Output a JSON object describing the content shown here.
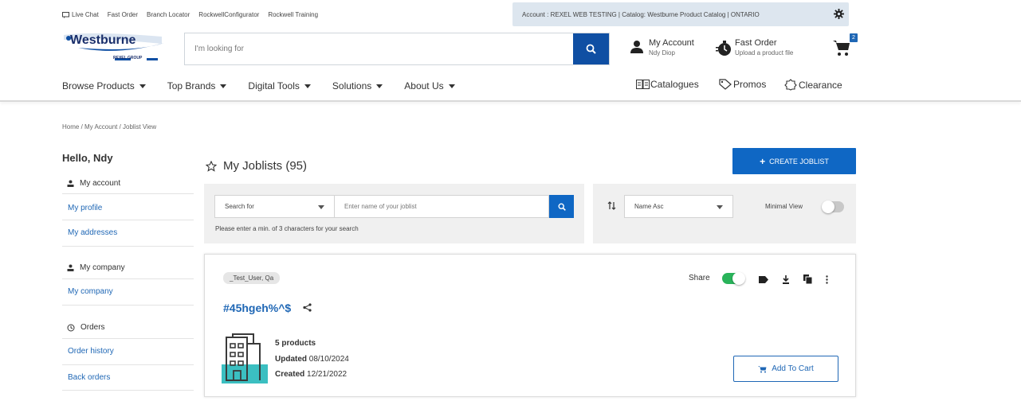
{
  "utility_bar": {
    "links": [
      "Live Chat",
      "Fast Order",
      "Branch Locator",
      "RockwellConfigurator",
      "Rockwell Training"
    ],
    "account_context": "Account : REXEL WEB TESTING  |  Catalog: Westburne Product Catalog  |  ONTARIO"
  },
  "header": {
    "logo_text": "Westburne",
    "logo_subtext": "REXEL GROUP",
    "search_placeholder": "I'm looking for",
    "my_account_label": "My Account",
    "my_account_user": "Ndy Diop",
    "fast_order_label": "Fast Order",
    "fast_order_sub": "Upload a product file",
    "cart_count": "2"
  },
  "nav": {
    "items": [
      "Browse Products",
      "Top Brands",
      "Digital Tools",
      "Solutions",
      "About Us"
    ],
    "catalogues": "Catalogues",
    "promos": "Promos",
    "clearance": "Clearance"
  },
  "breadcrumb": "Home  /  My Account  /  Joblist View",
  "sidebar": {
    "greeting": "Hello, Ndy",
    "my_account_heading": "My account",
    "my_profile": "My profile",
    "my_addresses": "My addresses",
    "my_company_heading": "My company",
    "my_company": "My company",
    "orders_heading": "Orders",
    "order_history": "Order history",
    "back_orders": "Back orders"
  },
  "main": {
    "title": "My Joblists (95)",
    "create_button": "CREATE JOBLIST",
    "search_for_select": "Search for",
    "search_placeholder": "Enter name of your joblist",
    "search_hint": "Please enter a min. of 3 characters for your search",
    "sort_select": "Name Asc",
    "minimal_view_label": "Minimal View",
    "minimal_view_on": false
  },
  "joblist": {
    "owner": "_Test_User, Qa",
    "share_label": "Share",
    "share_on": true,
    "name": "#45hgeh%^$",
    "products": "5 products",
    "updated_label": "Updated",
    "updated_date": "08/10/2024",
    "created_label": "Created",
    "created_date": "12/21/2022",
    "add_to_cart": "Add To Cart"
  },
  "colors": {
    "primary_blue": "#0f67c4",
    "dark_blue": "#0f4fa3",
    "link_blue": "#1f67b5",
    "toggle_green": "#29b35a",
    "account_bar": "#dde6ef",
    "panel_bg": "#f0f0f0"
  }
}
